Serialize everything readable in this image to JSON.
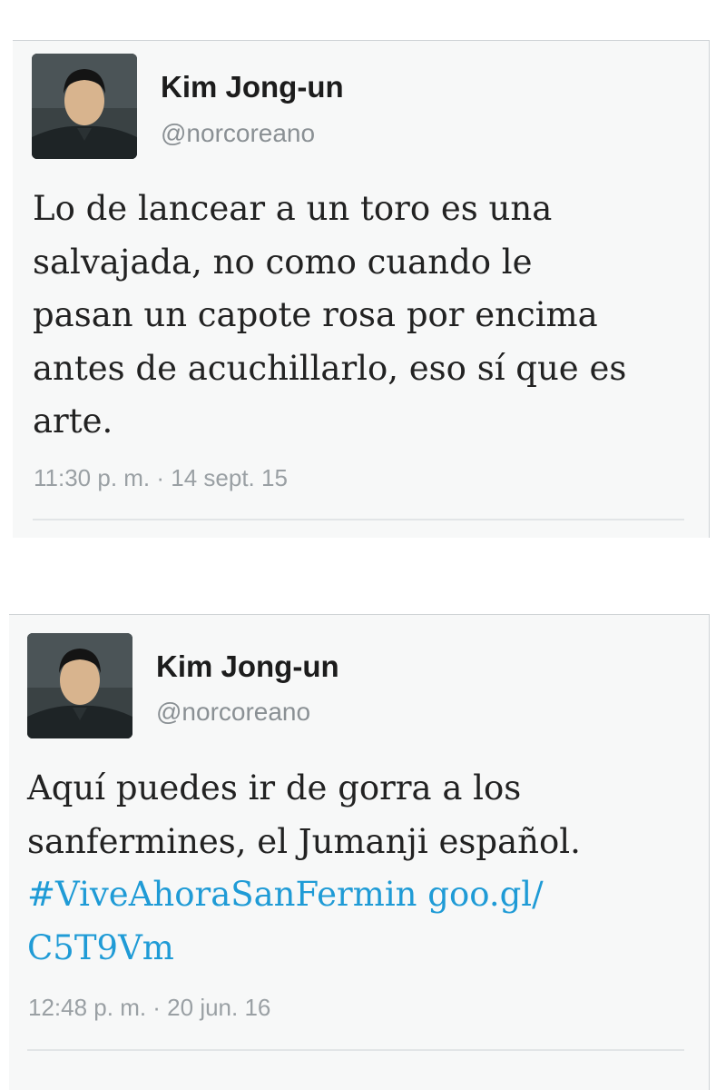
{
  "tweets": [
    {
      "author": {
        "name": "Kim Jong-un",
        "handle": "@norcoreano"
      },
      "text_lines": [
        "Lo de lancear a un toro es una",
        "salvajada, no como cuando le",
        "pasan un capote rosa por encima",
        "antes de acuchillarlo, eso sí que es",
        "arte."
      ],
      "timestamp": "11:30 p. m. · 14 sept. 15"
    },
    {
      "author": {
        "name": "Kim Jong-un",
        "handle": "@norcoreano"
      },
      "text_lines": [
        "Aquí puedes ir de gorra a los",
        "sanfermines, el Jumanji español."
      ],
      "hashtag": "#ViveAhoraSanFermin",
      "link_part1": "goo.gl/",
      "link_part2": "C5T9Vm",
      "timestamp": "12:48 p. m. · 20 jun. 16"
    }
  ],
  "colors": {
    "link": "#1f9bd6",
    "text": "#222222",
    "meta": "#9aa0a4"
  },
  "icons": {
    "avatar": "portrait-avatar"
  }
}
